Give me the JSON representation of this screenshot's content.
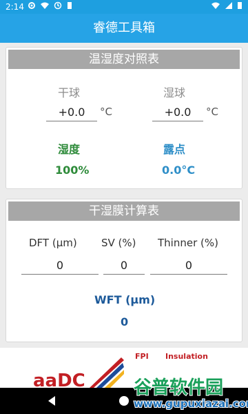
{
  "status": {
    "time": "2:14"
  },
  "app": {
    "title": "睿德工具箱"
  },
  "temp_card": {
    "header": "温湿度对照表",
    "dry_label": "干球",
    "wet_label": "湿球",
    "dry_value": "+0.0",
    "wet_value": "+0.0",
    "unit": "°C",
    "humidity_label": "湿度",
    "humidity_value": "100%",
    "dewpoint_label": "露点",
    "dewpoint_value": "0.0°C"
  },
  "film_card": {
    "header": "干湿膜计算表",
    "dft_label": "DFT (μm)",
    "sv_label": "SV (%)",
    "thinner_label": "Thinner (%)",
    "dft_value": "0",
    "sv_value": "0",
    "thinner_value": "0",
    "wft_label": "WFT (μm)",
    "wft_value": "0"
  },
  "logo": {
    "fragment_a": "FPI",
    "fragment_b": "Insulation"
  },
  "watermark": {
    "title": "谷普软件园",
    "url": "www.gupuxiazai.com"
  }
}
